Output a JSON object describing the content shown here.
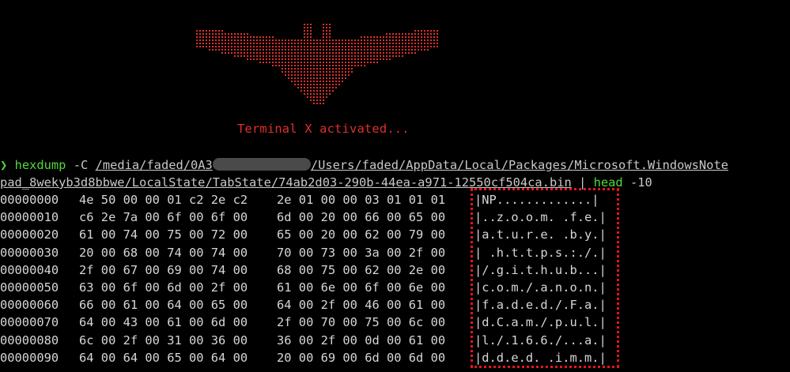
{
  "banner": {
    "activated_text": "Terminal X activated...",
    "color": "#e0302c"
  },
  "command": {
    "prompt_icon": "chevron-right-icon",
    "prompt_symbol": "❯",
    "program": "hexdump",
    "flag": "-C",
    "path_start": "/media/faded/0A3",
    "path_after_redaction": "/Users/faded/AppData/Local/Packages/Microsoft.WindowsNote",
    "path_line2": "pad_8wekyb3d8bbwe/LocalState/TabState/74ab2d03-290b-44ea-a971-12550cf504ca.bin",
    "pipe": "|",
    "head_cmd": "head",
    "head_arg": "-10"
  },
  "dump": [
    {
      "offset": "00000000",
      "hex1": "4e 50 00 00 01 c2 2e c2",
      "hex2": "2e 01 00 00 03 01 01 01",
      "ascii": "|NP.............|"
    },
    {
      "offset": "00000010",
      "hex1": "c6 2e 7a 00 6f 00 6f 00",
      "hex2": "6d 00 20 00 66 00 65 00",
      "ascii": "|..z.o.o.m. .f.e.|"
    },
    {
      "offset": "00000020",
      "hex1": "61 00 74 00 75 00 72 00",
      "hex2": "65 00 20 00 62 00 79 00",
      "ascii": "|a.t.u.r.e. .b.y.|"
    },
    {
      "offset": "00000030",
      "hex1": "20 00 68 00 74 00 74 00",
      "hex2": "70 00 73 00 3a 00 2f 00",
      "ascii": "| .h.t.t.p.s.:./.|"
    },
    {
      "offset": "00000040",
      "hex1": "2f 00 67 00 69 00 74 00",
      "hex2": "68 00 75 00 62 00 2e 00",
      "ascii": "|/.g.i.t.h.u.b...|"
    },
    {
      "offset": "00000050",
      "hex1": "63 00 6f 00 6d 00 2f 00",
      "hex2": "61 00 6e 00 6f 00 6e 00",
      "ascii": "|c.o.m./.a.n.o.n.|"
    },
    {
      "offset": "00000060",
      "hex1": "66 00 61 00 64 00 65 00",
      "hex2": "64 00 2f 00 46 00 61 00",
      "ascii": "|f.a.d.e.d./.F.a.|"
    },
    {
      "offset": "00000070",
      "hex1": "64 00 43 00 61 00 6d 00",
      "hex2": "2f 00 70 00 75 00 6c 00",
      "ascii": "|d.C.a.m./.p.u.l.|"
    },
    {
      "offset": "00000080",
      "hex1": "6c 00 2f 00 31 00 36 00",
      "hex2": "36 00 2f 00 0d 00 61 00",
      "ascii": "|l./.1.6.6./...a.|"
    },
    {
      "offset": "00000090",
      "hex1": "64 00 64 00 65 00 64 00",
      "hex2": "20 00 69 00 6d 00 6d 00",
      "ascii": "|d.d.e.d. .i.m.m.|"
    }
  ],
  "highlight_color": "#e3161b",
  "prompt_color": "#4fd93a"
}
